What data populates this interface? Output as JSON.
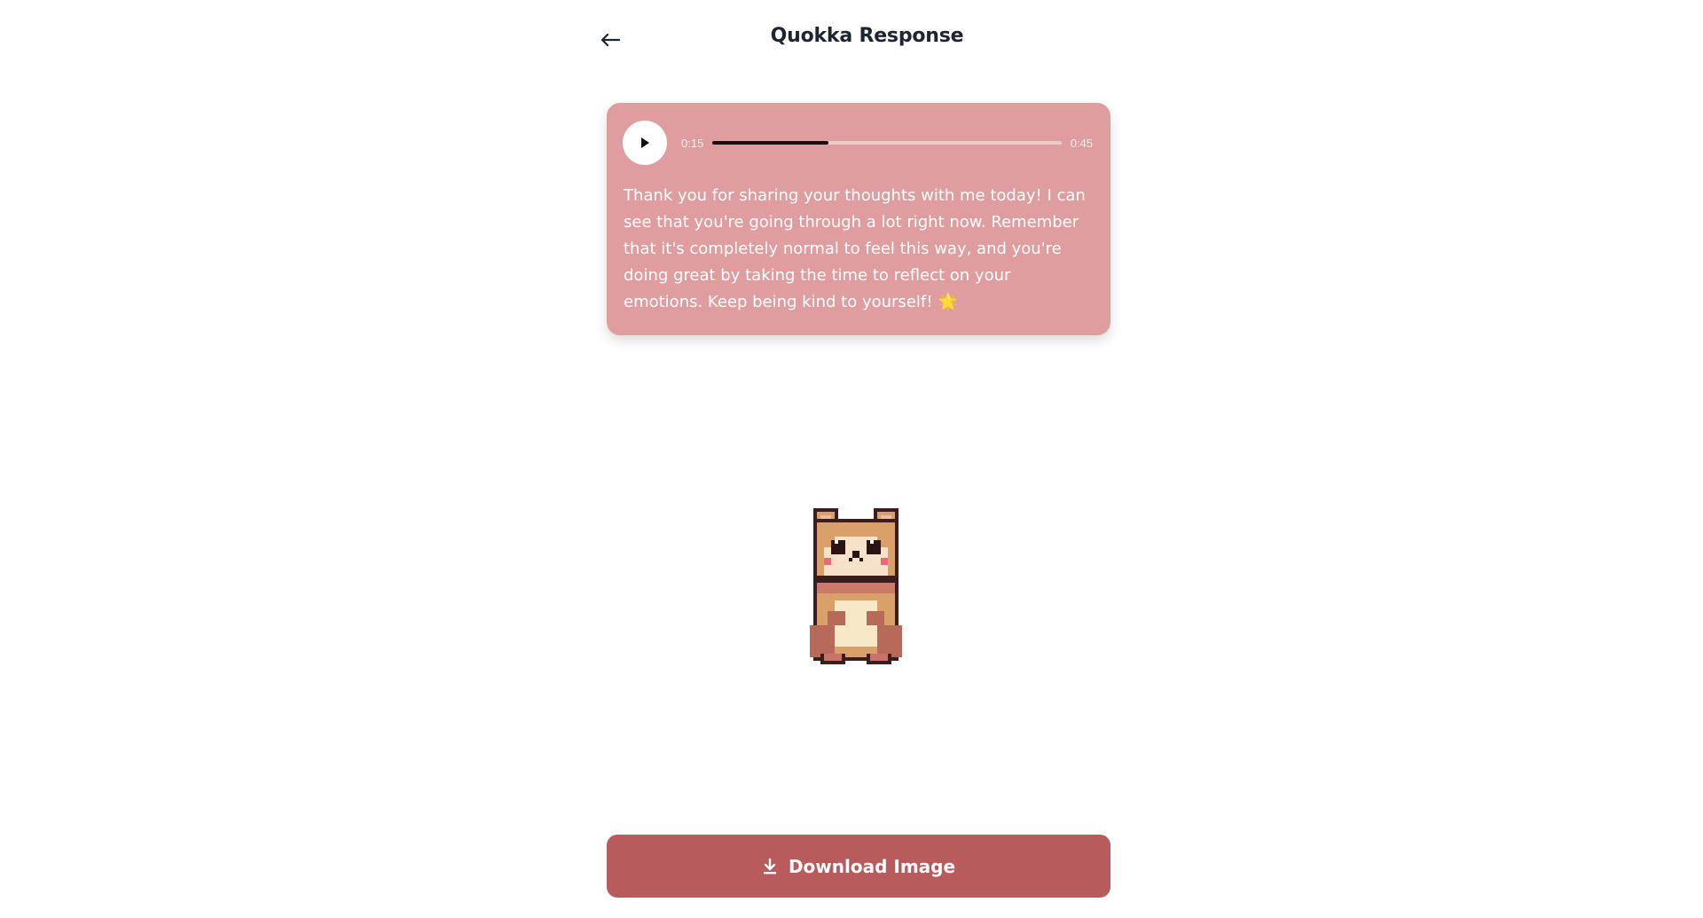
{
  "header": {
    "title": "Quokka Response",
    "back_icon": "arrow-left-icon"
  },
  "audio": {
    "current_time": "0:15",
    "total_time": "0:45",
    "progress_fraction": 0.333,
    "play_icon": "play-icon"
  },
  "response": {
    "text": "Thank you for sharing your thoughts with me today! I can see that you're going through a lot right now. Remember that it's completely normal to feel this way, and you're doing great by taking the time to reflect on your emotions. Keep being kind to yourself!",
    "emoji": "🌟"
  },
  "image": {
    "subject_icon": "quokka-pixel-art"
  },
  "actions": {
    "download_label": "Download Image",
    "download_icon": "download-icon"
  },
  "colors": {
    "card_background": "#e09d9f",
    "button_background": "#b85b5d",
    "progress_fill": "#111111"
  }
}
